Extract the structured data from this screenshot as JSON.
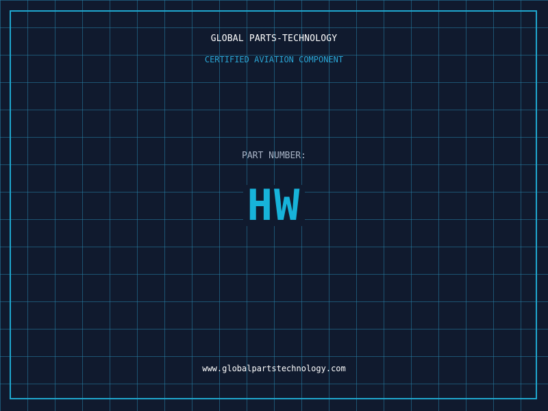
{
  "brand": {
    "title": "GLOBAL PARTS-TECHNOLOGY",
    "subtitle": "CERTIFIED AVIATION COMPONENT"
  },
  "part": {
    "label": "PART NUMBER:",
    "code": "HW"
  },
  "footer": {
    "website": "www.globalpartstechnology.com"
  },
  "colors": {
    "background": "#101a2e",
    "grid": "#2882aa",
    "frame": "#1fa8cf",
    "accent": "#17b3da",
    "title": "#ffffff",
    "label": "#a9b4c6"
  }
}
